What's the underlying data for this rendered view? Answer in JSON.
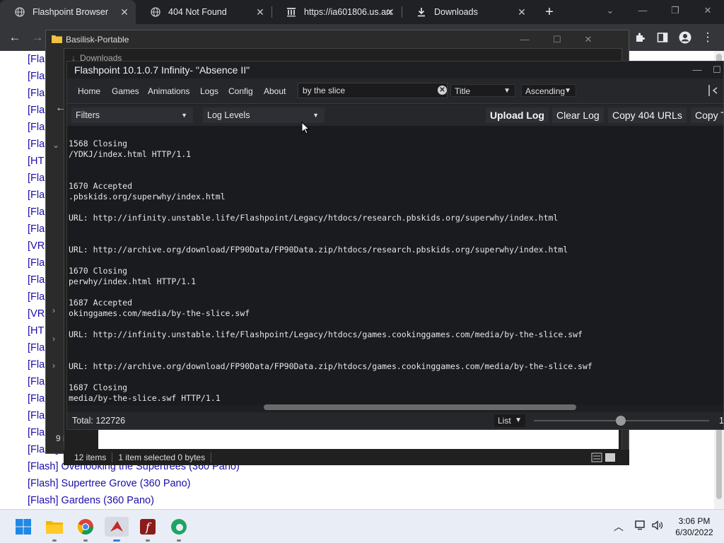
{
  "browser": {
    "tabs": [
      {
        "title": "Flashpoint Browser",
        "icon": "globe-icon",
        "active": true
      },
      {
        "title": "404 Not Found",
        "icon": "globe-icon",
        "active": false
      },
      {
        "title": "https://ia601806.us.arc",
        "icon": "archive-icon",
        "active": false
      },
      {
        "title": "Downloads",
        "icon": "download-icon",
        "active": false
      }
    ],
    "new_tab_glyph": "+",
    "window_controls": {
      "minimize": "—",
      "restore": "❐",
      "close": "✕"
    }
  },
  "page": {
    "links": [
      "[Fla",
      "[Fla",
      "[Fla",
      "[Fla",
      "[Fla",
      "[Fla",
      "[HT",
      "[Fla",
      "[Fla",
      "[Fla",
      "[Fla",
      "[VR",
      "[Fla",
      "[Fla",
      "[Fla",
      "[VR",
      "[HT",
      "[Fla",
      "[Fla",
      "[Fla",
      "[Fla",
      "[Fla",
      "[Fla",
      "[Flash]",
      "[Flash] Overlooking the Supertrees (360 Pano)",
      "[Flash] Supertree Grove (360 Pano)",
      "[Flash] Gardens (360 Pano)"
    ]
  },
  "basilisk": {
    "title": "Basilisk-Portable",
    "side_label": "9 i"
  },
  "downloads": {
    "title": "Downloads",
    "status_items": "12 items",
    "status_selected": "1 item selected  0 bytes"
  },
  "flashpoint": {
    "title": "Flashpoint 10.1.0.7 Infinity- \"Absence II\"",
    "menu": [
      "Home",
      "Games",
      "Animations",
      "Logs",
      "Config",
      "About"
    ],
    "search_value": "by the slice",
    "sort_field": "Title",
    "sort_order": "Ascending",
    "filters_label": "Filters",
    "log_levels_label": "Log Levels",
    "buttons": [
      "Upload Log",
      "Clear Log",
      "Copy 404 URLs",
      "Copy T"
    ],
    "log_lines": [
      {
        "text": "1568 Closing"
      },
      {
        "text": "/YDKJ/index.html HTTP/1.1"
      },
      {
        "text": "1670 Accepted"
      },
      {
        "text": ".pbskids.org/superwhy/index.html"
      },
      {
        "text": "URL: http://infinity.unstable.life/Flashpoint/Legacy/htdocs/research.pbskids.org/superwhy/index.html"
      },
      {
        "text": "URL: http://archive.org/download/FP90Data/FP90Data.zip/htdocs/research.pbskids.org/superwhy/index.html"
      },
      {
        "text": "1670 Closing"
      },
      {
        "text": "perwhy/index.html HTTP/1.1"
      },
      {
        "text": "1687 Accepted"
      },
      {
        "text": "okinggames.com/media/by-the-slice.swf"
      },
      {
        "text": "URL: http://infinity.unstable.life/Flashpoint/Legacy/htdocs/games.cookinggames.com/media/by-the-slice.swf"
      },
      {
        "prefix": "URL: ",
        "text": "http://archive.org/download/FP90Data/FP90Data.zip/htdocs/games.cookinggames.com/media/by-the-slice.swf"
      },
      {
        "text": "1687 Closing"
      },
      {
        "text": "media/by-the-slice.swf HTTP/1.1"
      }
    ],
    "total": "Total: 122726",
    "view_mode": "List",
    "slider_value": "1"
  },
  "taskbar": {
    "apps": [
      "windows-start-icon",
      "file-explorer-icon",
      "chrome-icon",
      "flashpoint-icon",
      "flash-player-icon",
      "edge-icon"
    ],
    "time": "3:06 PM",
    "date": "6/30/2022"
  }
}
